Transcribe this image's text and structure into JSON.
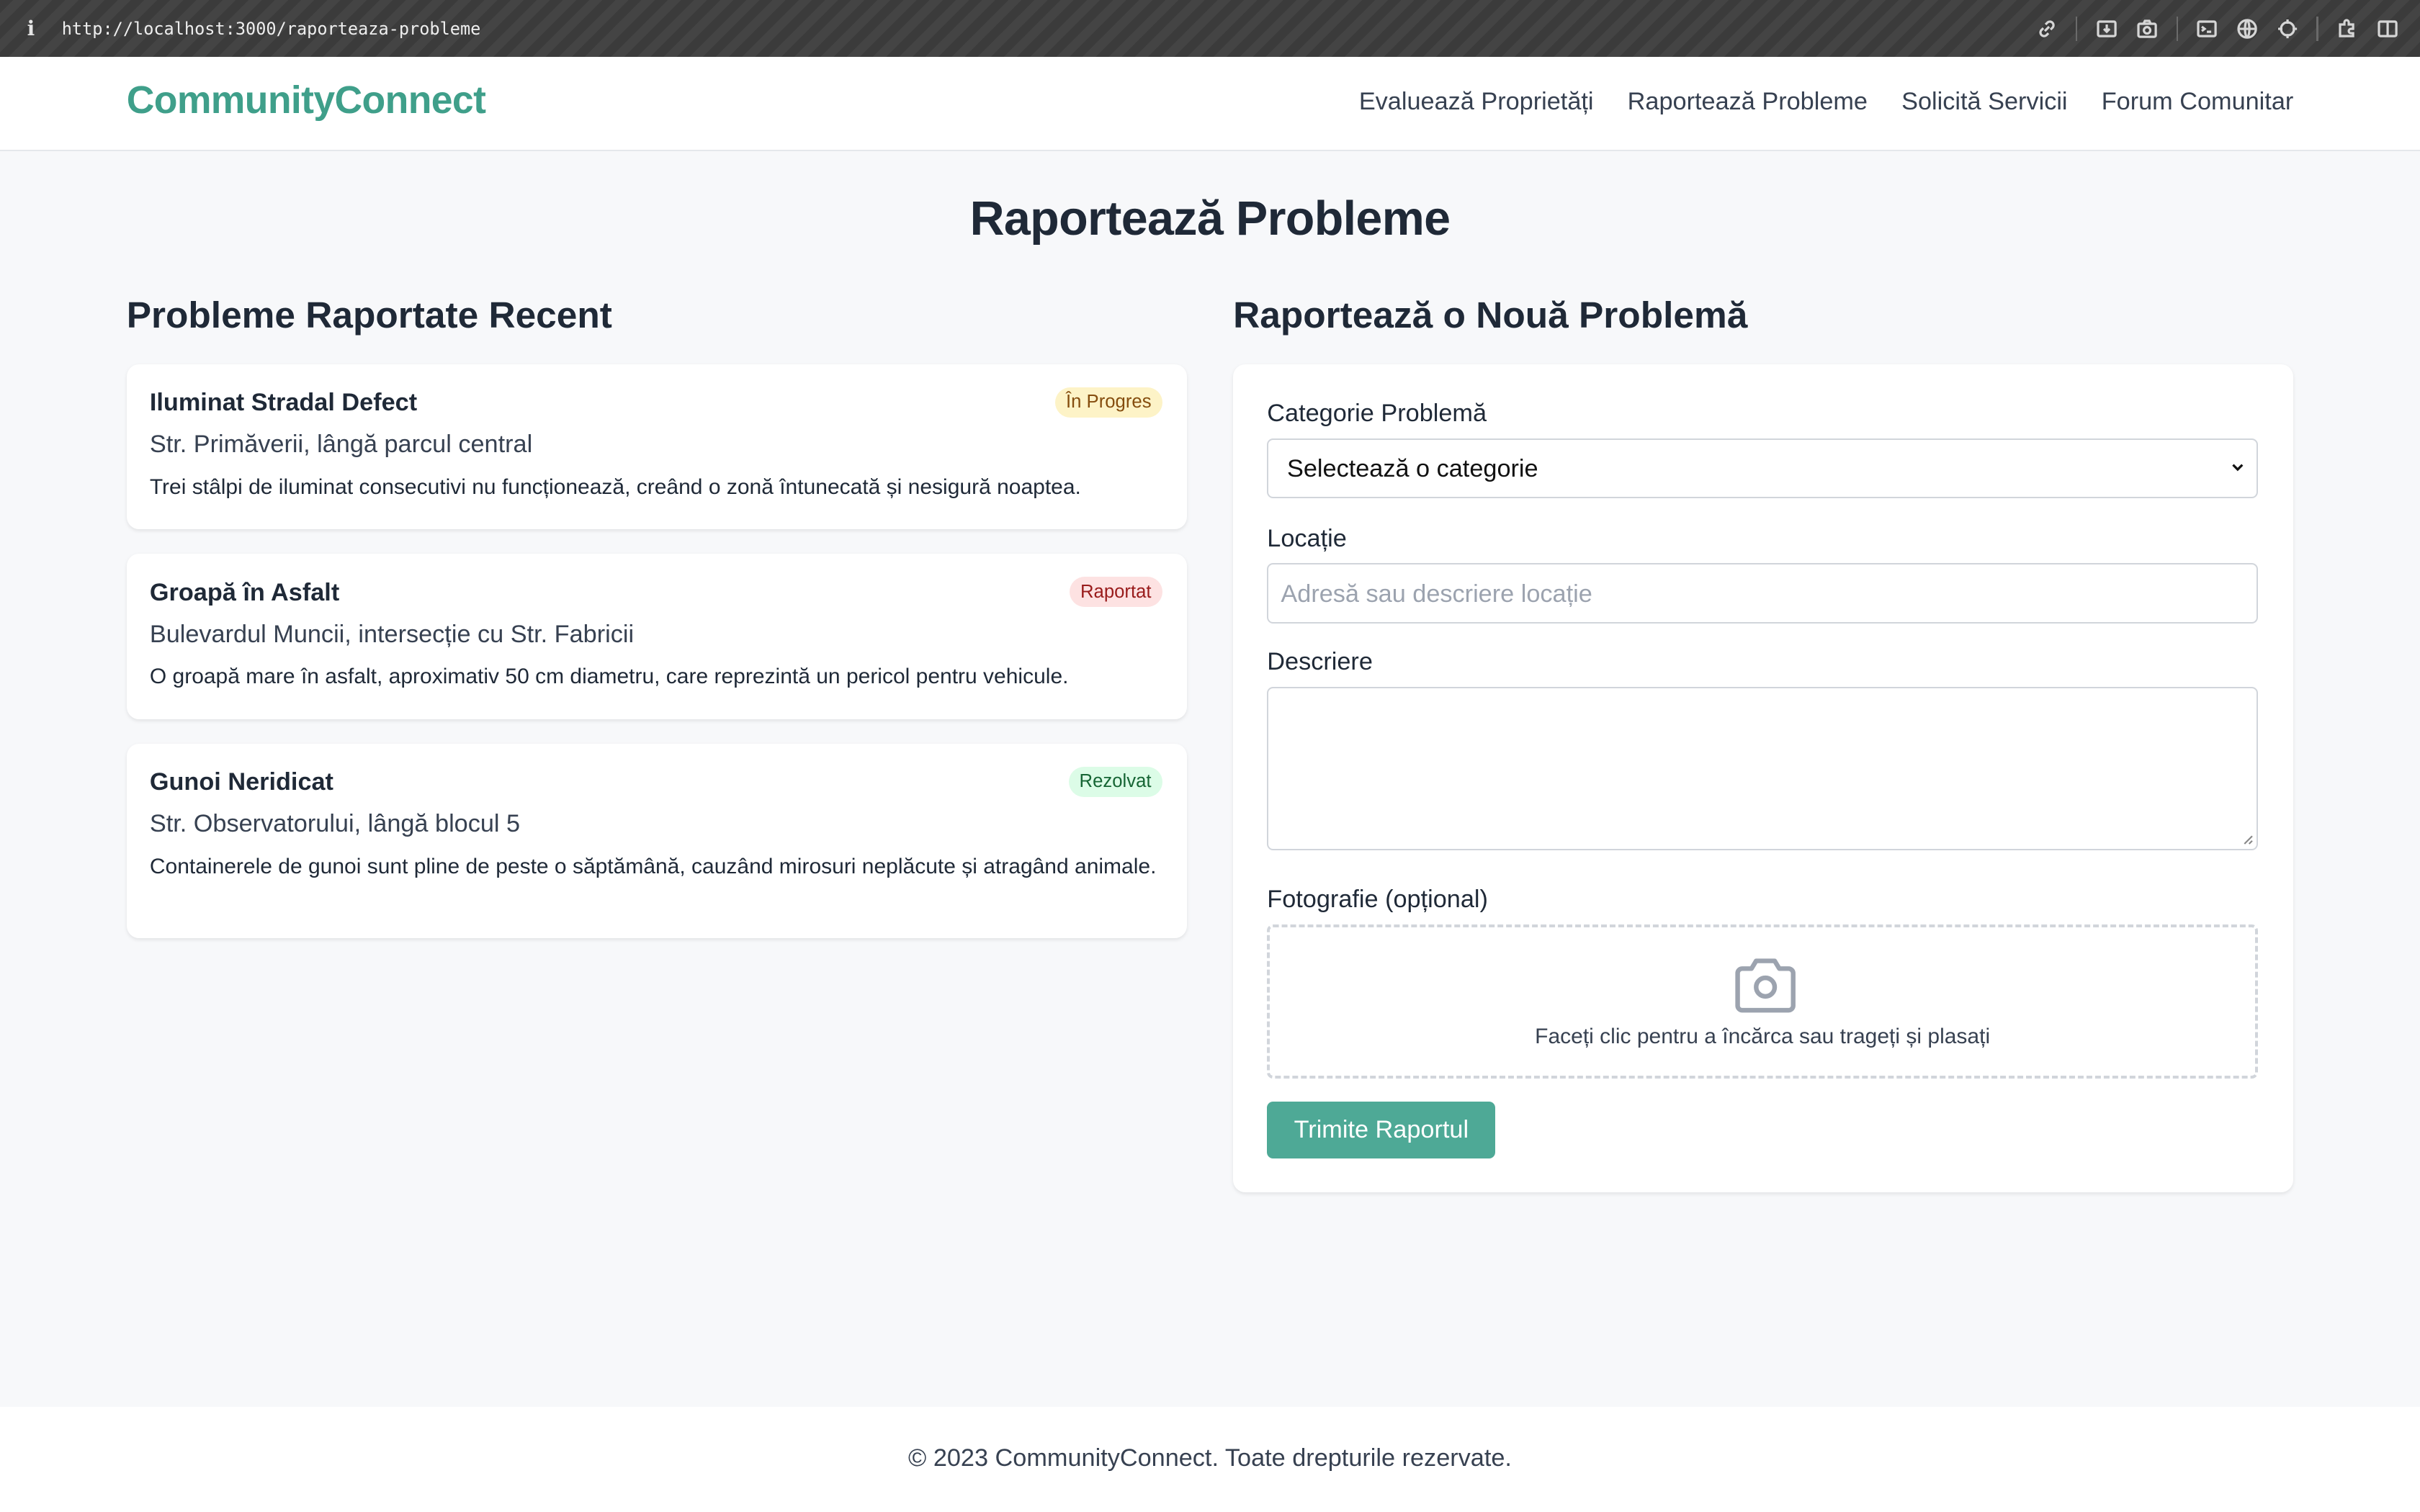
{
  "browser": {
    "url": "http://localhost:3000/raporteaza-probleme"
  },
  "header": {
    "logo": "CommunityConnect",
    "nav": [
      {
        "label": "Evaluează Proprietăți"
      },
      {
        "label": "Raportează Probleme"
      },
      {
        "label": "Solicită Servicii"
      },
      {
        "label": "Forum Comunitar"
      }
    ]
  },
  "page_title": "Raportează Probleme",
  "recent": {
    "title": "Probleme Raportate Recent",
    "issues": [
      {
        "title": "Iluminat Stradal Defect",
        "status": "În Progres",
        "location": "Str. Primăverii, lângă parcul central",
        "description": "Trei stâlpi de iluminat consecutivi nu funcționează, creând o zonă întunecată și nesigură noaptea."
      },
      {
        "title": "Groapă în Asfalt",
        "status": "Raportat",
        "location": "Bulevardul Muncii, intersecție cu Str. Fabricii",
        "description": "O groapă mare în asfalt, aproximativ 50 cm diametru, care reprezintă un pericol pentru vehicule."
      },
      {
        "title": "Gunoi Neridicat",
        "status": "Rezolvat",
        "location": "Str. Observatorului, lângă blocul 5",
        "description": "Containerele de gunoi sunt pline de peste o săptămână, cauzând mirosuri neplăcute și atragând animale."
      }
    ]
  },
  "form": {
    "title": "Raportează o Nouă Problemă",
    "category_label": "Categorie Problemă",
    "category_value": "Selectează o categorie",
    "location_label": "Locație",
    "location_placeholder": "Adresă sau descriere locație",
    "description_label": "Descriere",
    "description_value": "",
    "photo_label": "Fotografie (opțional)",
    "photo_hint": "Faceți clic pentru a încărca sau trageți și plasați",
    "submit_label": "Trimite Raportul"
  },
  "footer": "© 2023 CommunityConnect. Toate drepturile rezervate."
}
